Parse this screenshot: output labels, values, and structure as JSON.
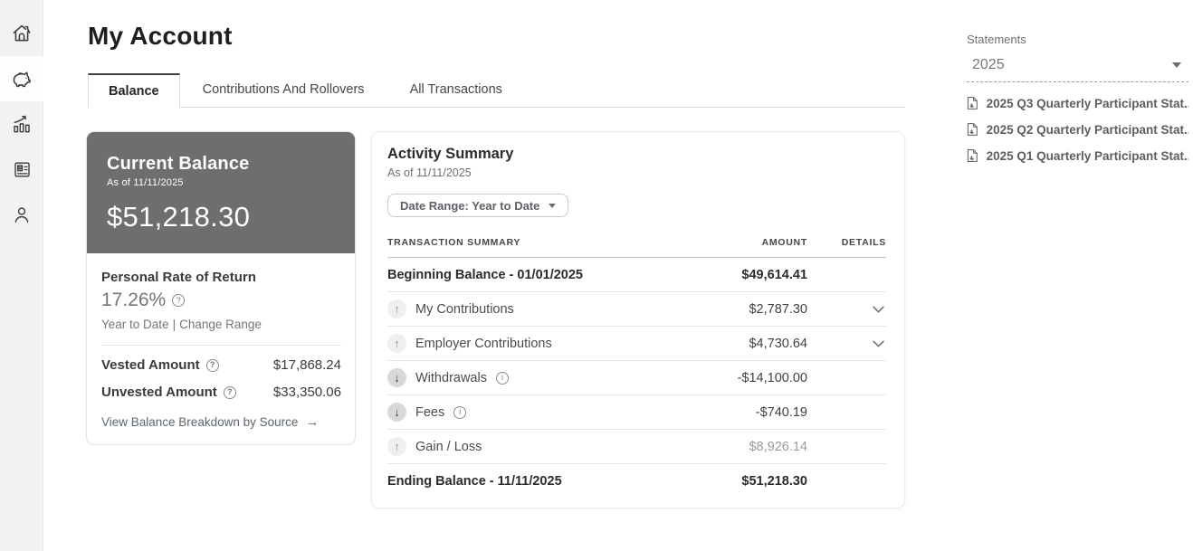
{
  "page": {
    "title": "My Account"
  },
  "sidebar": {
    "items": [
      {
        "id": "home",
        "icon": "home-icon",
        "selected": false
      },
      {
        "id": "savings",
        "icon": "piggy-bank-icon",
        "selected": true
      },
      {
        "id": "performance",
        "icon": "chart-icon",
        "selected": false
      },
      {
        "id": "statements",
        "icon": "statements-icon",
        "selected": false
      },
      {
        "id": "profile",
        "icon": "profile-icon",
        "selected": false
      }
    ]
  },
  "tabs": [
    {
      "label": "Balance",
      "active": true
    },
    {
      "label": "Contributions And Rollovers",
      "active": false
    },
    {
      "label": "All Transactions",
      "active": false
    }
  ],
  "balance_card": {
    "title": "Current Balance",
    "as_of": "As of 11/11/2025",
    "amount": "$51,218.30",
    "ror_label": "Personal Rate of Return",
    "ror_value": "17.26%",
    "ror_period": "Year to Date",
    "ror_separator": "|",
    "ror_change_link": "Change Range",
    "vested_label": "Vested Amount",
    "vested_value": "$17,868.24",
    "unvested_label": "Unvested Amount",
    "unvested_value": "$33,350.06",
    "breakdown_link": "View Balance Breakdown by Source"
  },
  "activity": {
    "title": "Activity Summary",
    "as_of": "As of 11/11/2025",
    "date_range_button": "Date Range: Year to Date",
    "table": {
      "headers": [
        "TRANSACTION SUMMARY",
        "AMOUNT",
        "DETAILS"
      ],
      "rows": [
        {
          "label": "Beginning Balance - 01/01/2025",
          "amount": "$49,614.41"
        },
        {
          "label": "My Contributions",
          "amount": "$2,787.30"
        },
        {
          "label": "Employer Contributions",
          "amount": "$4,730.64"
        },
        {
          "label": "Withdrawals",
          "amount": "-$14,100.00"
        },
        {
          "label": "Fees",
          "amount": "-$740.19"
        },
        {
          "label": "Gain / Loss",
          "amount": "$8,926.14"
        },
        {
          "label": "Ending Balance - 11/11/2025",
          "amount": "$51,218.30"
        }
      ]
    }
  },
  "statements": {
    "title": "Statements",
    "year_select": "2025",
    "items": [
      "2025 Q3 Quarterly Participant Stat...",
      "2025 Q2 Quarterly Participant Stat...",
      "2025 Q1 Quarterly Participant Stat..."
    ]
  },
  "icons": {
    "up_arrow": "↑",
    "down_arrow": "↓",
    "right_arrow": "→",
    "help": "?",
    "info": "i"
  },
  "colors": {
    "balance_header_bg": "#6e6e6e",
    "sidebar_bg": "#f3f2f2",
    "accent_text": "#75757a"
  }
}
